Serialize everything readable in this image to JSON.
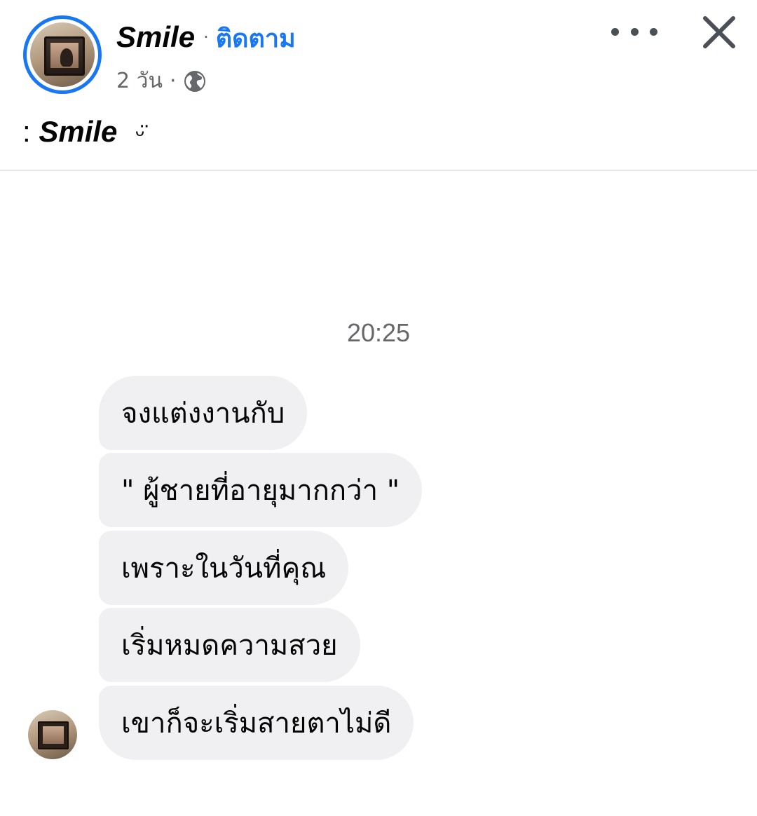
{
  "post": {
    "author_name": "Smile",
    "separator": "·",
    "follow_label": "ติดตาม",
    "timestamp": "2 วัน",
    "meta_separator": "·",
    "audience_icon": "globe-icon",
    "more_icon": "more-horizontal-icon",
    "close_icon": "close-icon",
    "caption": {
      "prefix": ":",
      "name": "Smile",
      "emoticon": "ᵕ̈"
    }
  },
  "chat": {
    "time": "20:25",
    "messages": [
      "จงแต่งงานกับ",
      "\" ผู้ชายที่อายุมากกว่า \"",
      "เพราะในวันที่คุณ",
      "เริ่มหมดความสวย",
      "เขาก็จะเริ่มสายตาไม่ดี"
    ]
  },
  "colors": {
    "accent": "#1877f2",
    "secondary_text": "#65676b",
    "bubble": "#f0f0f2",
    "divider": "#e4e6eb"
  }
}
